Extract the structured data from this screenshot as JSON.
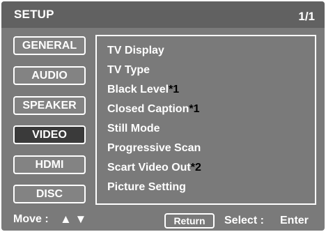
{
  "title": "SETUP",
  "page_indicator": "1/1",
  "tabs": [
    {
      "label": "GENERAL"
    },
    {
      "label": "AUDIO"
    },
    {
      "label": "SPEAKER"
    },
    {
      "label": "VIDEO"
    },
    {
      "label": "HDMI"
    },
    {
      "label": "DISC"
    }
  ],
  "active_tab": "VIDEO",
  "menu": [
    {
      "label": "TV Display",
      "note": ""
    },
    {
      "label": "TV Type",
      "note": ""
    },
    {
      "label": "Black Level",
      "note": "*1"
    },
    {
      "label": "Closed Caption",
      "note": "*1"
    },
    {
      "label": "Still Mode",
      "note": ""
    },
    {
      "label": "Progressive Scan",
      "note": ""
    },
    {
      "label": "Scart Video Out",
      "note": "*2"
    },
    {
      "label": "Picture Setting",
      "note": ""
    }
  ],
  "footer": {
    "move_label": "Move :",
    "move_icons": "▲ ▼",
    "return_label": "Return",
    "select_label": "Select :",
    "enter_label": "Enter"
  },
  "colors": {
    "background": "#7a7a7a",
    "title_bar": "#616161",
    "active_tab": "#3a3a3a",
    "text": "#ffffff",
    "note": "#000000"
  }
}
